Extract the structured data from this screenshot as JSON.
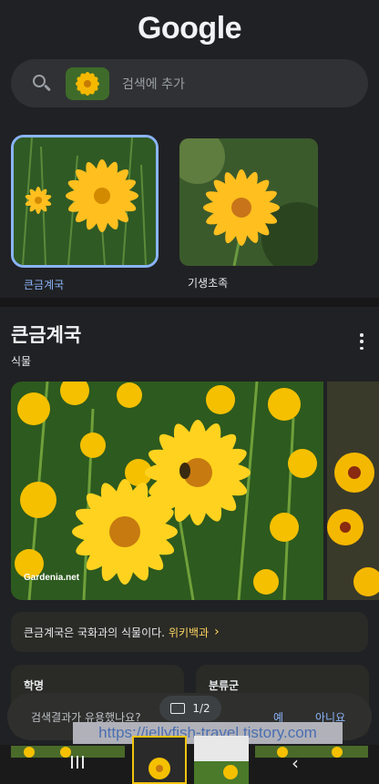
{
  "header": {
    "logo": "Google"
  },
  "search": {
    "placeholder": "검색에 추가"
  },
  "results": [
    {
      "label": "큰금계국",
      "selected": true
    },
    {
      "label": "기생초족",
      "selected": false
    }
  ],
  "entity": {
    "title": "큰금계국",
    "subtitle": "식물",
    "image_credit": "Gardenia.net"
  },
  "description": {
    "text": "큰금계국은 국화과의 식물이다.",
    "link": "위키백과"
  },
  "info_cards": [
    {
      "title": "학명"
    },
    {
      "title": "분류군"
    }
  ],
  "feedback": {
    "question": "검색결과가 유용했나요?",
    "yes": "예",
    "no": "아니요"
  },
  "pager": {
    "text": "1/2"
  },
  "overlay": {
    "url": "https://jellyfish-travel.tistory.com"
  },
  "colors": {
    "accent_blue": "#8ab4f8",
    "link_yellow": "#fdd663",
    "background": "#202124"
  }
}
